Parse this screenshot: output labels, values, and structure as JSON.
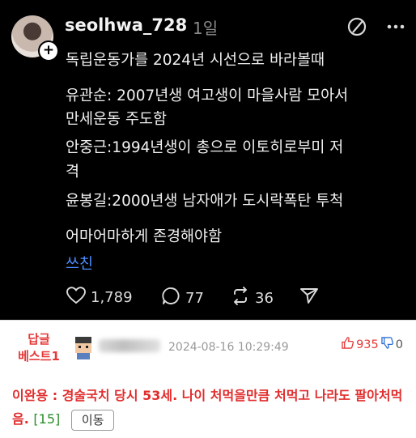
{
  "post": {
    "username": "seolhwa_728",
    "time": "1일",
    "lines": [
      "독립운동가를 2024년 시선으로 바라볼때",
      "유관순: 2007년생 여고생이 마을사람 모아서",
      "만세운동 주도함",
      "안중근:1994년생이 총으로 이토히로부미 저",
      "격",
      "윤봉길:2000년생 남자애가 도시락폭탄 투척",
      "어마어마하게 존경해야함"
    ],
    "translate": "쓰친",
    "likes": "1,789",
    "comments": "77",
    "reposts": "36"
  },
  "comment": {
    "best_line1": "답글",
    "best_line2": "베스트1",
    "date": "2024-08-16 10:29:49",
    "upvotes": "935",
    "downvotes": "0",
    "text": "이완용 : 경술국치 당시 53세. 나이 처먹을만큼 처먹고 나라도 팔아처먹음.",
    "reply_count": "[15]",
    "move_button": "이동"
  }
}
